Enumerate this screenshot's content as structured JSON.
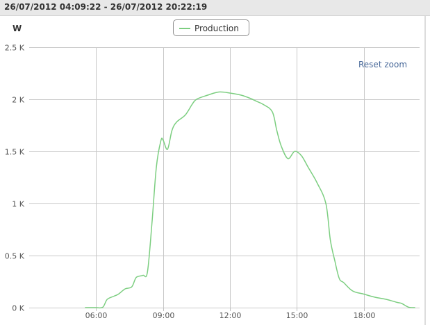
{
  "header": {
    "title": "26/07/2012 04:09:22 - 26/07/2012 20:22:19"
  },
  "reset_zoom_label": "Reset zoom",
  "chart_data": {
    "type": "line",
    "ylabel": "W",
    "y_ticks": [
      0,
      500,
      1000,
      1500,
      2000,
      2500
    ],
    "y_tick_labels": [
      "0 K",
      "0.5 K",
      "1 K",
      "1.5 K",
      "2 K",
      "2.5 K"
    ],
    "ylim": [
      0,
      2500
    ],
    "x_ticks": [
      6,
      9,
      12,
      15,
      18
    ],
    "x_tick_labels": [
      "06:00",
      "09:00",
      "12:00",
      "15:00",
      "18:00"
    ],
    "xlim": [
      3,
      20.5
    ],
    "grid": true,
    "legend_position": "top-center",
    "series": [
      {
        "name": "Production",
        "color": "#7cce80",
        "x": [
          5.5,
          6.0,
          6.3,
          6.5,
          6.8,
          7.0,
          7.3,
          7.6,
          7.8,
          8.1,
          8.3,
          8.5,
          8.7,
          8.9,
          9.0,
          9.2,
          9.4,
          9.6,
          10.0,
          10.3,
          10.5,
          11.0,
          11.5,
          12.0,
          12.5,
          12.9,
          13.2,
          13.5,
          13.9,
          14.1,
          14.3,
          14.6,
          14.9,
          15.2,
          15.5,
          15.9,
          16.3,
          16.5,
          16.7,
          16.9,
          17.1,
          17.5,
          18.0,
          18.5,
          19.0,
          19.5,
          19.7,
          20.0,
          20.3
        ],
        "y": [
          0,
          0,
          5,
          80,
          110,
          130,
          180,
          200,
          290,
          310,
          340,
          800,
          1350,
          1600,
          1610,
          1520,
          1700,
          1780,
          1850,
          1950,
          2000,
          2040,
          2070,
          2060,
          2040,
          2010,
          1980,
          1950,
          1880,
          1700,
          1550,
          1430,
          1500,
          1460,
          1350,
          1200,
          1000,
          650,
          450,
          280,
          240,
          160,
          130,
          100,
          80,
          50,
          40,
          5,
          0
        ]
      }
    ]
  }
}
